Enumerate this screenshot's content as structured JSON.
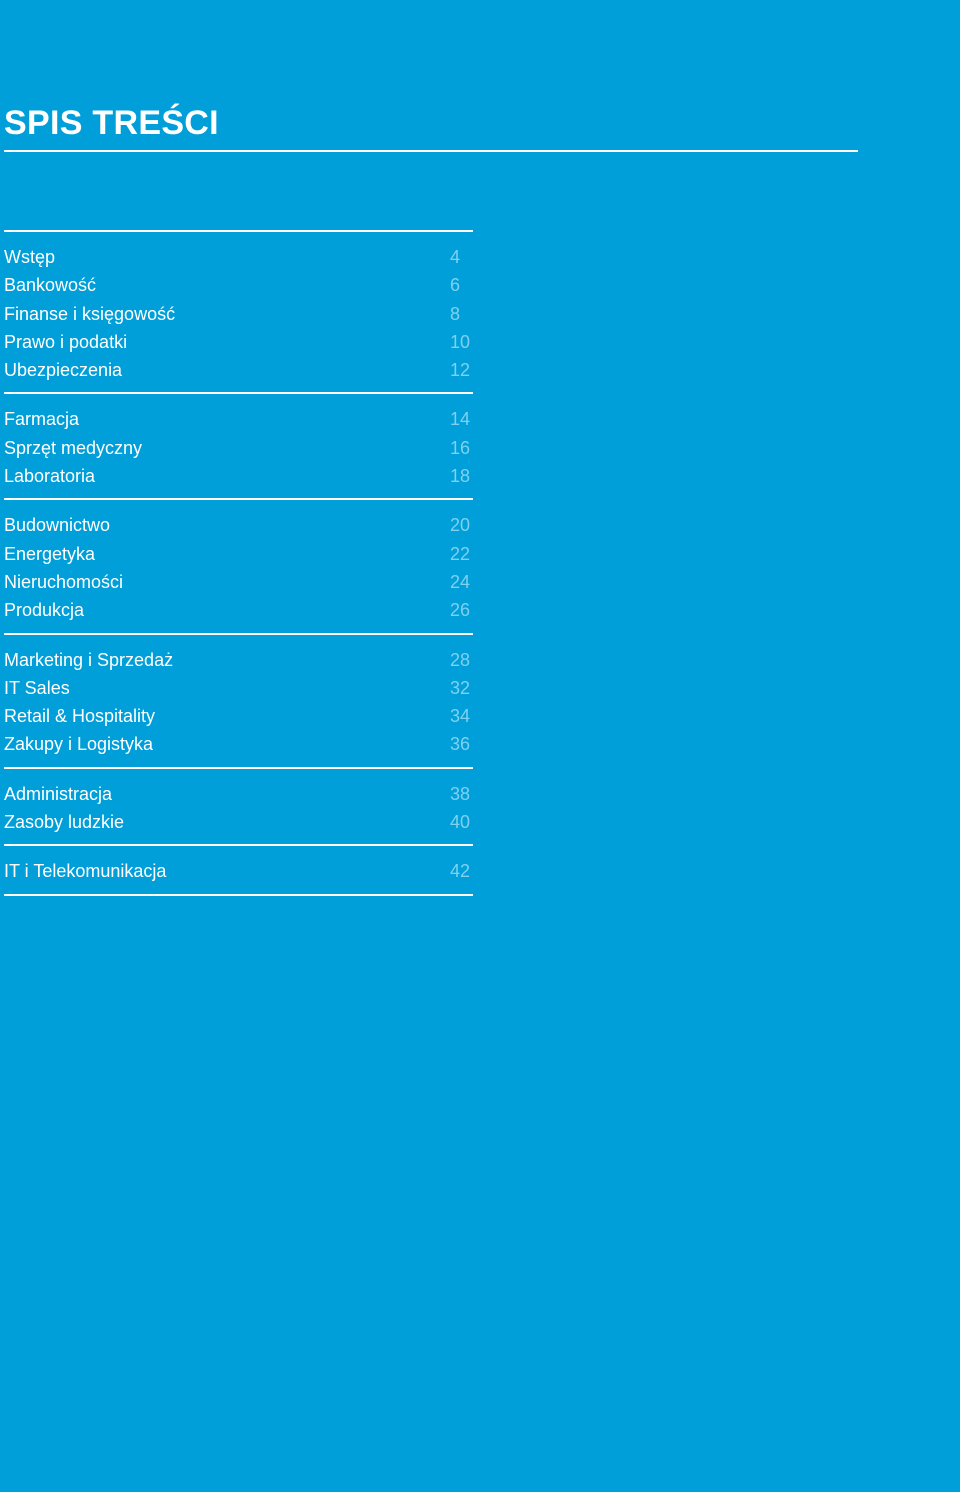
{
  "title": "SPIS TREŚCI",
  "groups": [
    {
      "entries": [
        {
          "label": "Wstęp",
          "page": "4"
        },
        {
          "label": "Bankowość",
          "page": "6"
        },
        {
          "label": "Finanse i księgowość",
          "page": "8"
        },
        {
          "label": "Prawo i podatki",
          "page": "10"
        },
        {
          "label": "Ubezpieczenia",
          "page": "12"
        }
      ]
    },
    {
      "entries": [
        {
          "label": "Farmacja",
          "page": "14"
        },
        {
          "label": "Sprzęt medyczny",
          "page": "16"
        },
        {
          "label": "Laboratoria",
          "page": "18"
        }
      ]
    },
    {
      "entries": [
        {
          "label": "Budownictwo",
          "page": "20"
        },
        {
          "label": "Energetyka",
          "page": "22"
        },
        {
          "label": "Nieruchomości",
          "page": "24"
        },
        {
          "label": "Produkcja",
          "page": "26"
        }
      ]
    },
    {
      "entries": [
        {
          "label": "Marketing i Sprzedaż",
          "page": "28"
        },
        {
          "label": "IT Sales",
          "page": "32"
        },
        {
          "label": "Retail & Hospitality",
          "page": "34"
        },
        {
          "label": "Zakupy i Logistyka",
          "page": "36"
        }
      ]
    },
    {
      "entries": [
        {
          "label": "Administracja",
          "page": "38"
        },
        {
          "label": "Zasoby ludzkie",
          "page": "40"
        }
      ]
    },
    {
      "entries": [
        {
          "label": "IT i Telekomunikacja",
          "page": "42"
        }
      ]
    }
  ],
  "colors": {
    "background": "#009fd9",
    "text": "#ffffff",
    "page_number": "#7fd1ef",
    "rule": "#ffffff"
  }
}
